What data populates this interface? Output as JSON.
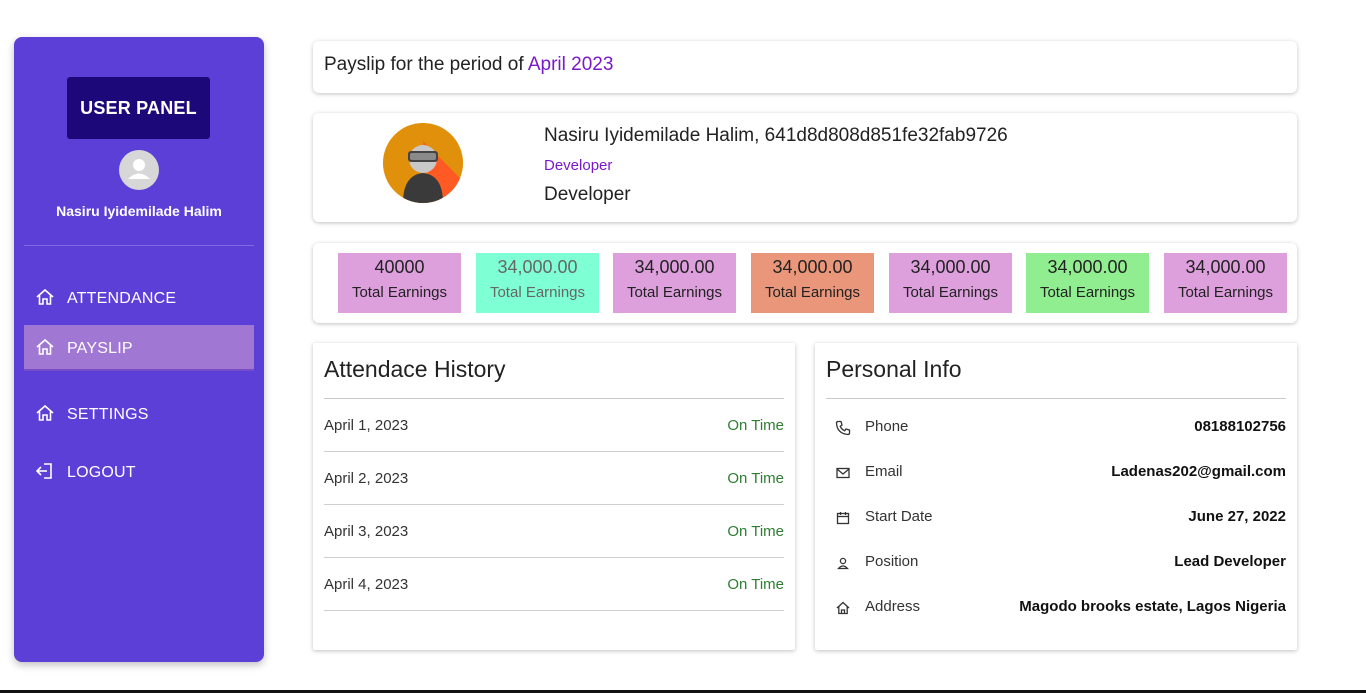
{
  "sidebar": {
    "panel_title": "USER PANEL",
    "user_name": "Nasiru Iyidemilade Halim",
    "items": [
      {
        "label": "ATTENDANCE",
        "icon": "home-icon",
        "active": false
      },
      {
        "label": "PAYSLIP",
        "icon": "home-icon",
        "active": true
      },
      {
        "label": "SETTINGS",
        "icon": "home-icon",
        "active": false
      },
      {
        "label": "LOGOUT",
        "icon": "logout-icon",
        "active": false
      }
    ]
  },
  "period": {
    "prefix": "Payslip for the period of ",
    "value": "April 2023"
  },
  "profile": {
    "name_line": "Nasiru Iyidemilade Halim, 641d8d808d851fe32fab9726",
    "role_small": "Developer",
    "role_large": "Developer"
  },
  "earnings": [
    {
      "amount": "40000",
      "label": "Total Earnings",
      "bg": "#dda0dd",
      "color": "#222222"
    },
    {
      "amount": "34,000.00",
      "label": "Total Earnings",
      "bg": "#7fffd4",
      "color": "#666666"
    },
    {
      "amount": "34,000.00",
      "label": "Total Earnings",
      "bg": "#dda0dd",
      "color": "#222222"
    },
    {
      "amount": "34,000.00",
      "label": "Total Earnings",
      "bg": "#e9967a",
      "color": "#222222"
    },
    {
      "amount": "34,000.00",
      "label": "Total Earnings",
      "bg": "#dda0dd",
      "color": "#222222"
    },
    {
      "amount": "34,000.00",
      "label": "Total Earnings",
      "bg": "#90ee90",
      "color": "#222222"
    },
    {
      "amount": "34,000.00",
      "label": "Total Earnings",
      "bg": "#dda0dd",
      "color": "#222222"
    }
  ],
  "attendance": {
    "title": "Attendace History",
    "rows": [
      {
        "date": "April 1, 2023",
        "status": "On Time"
      },
      {
        "date": "April 2, 2023",
        "status": "On Time"
      },
      {
        "date": "April 3, 2023",
        "status": "On Time"
      },
      {
        "date": "April 4, 2023",
        "status": "On Time"
      }
    ]
  },
  "personal": {
    "title": "Personal Info",
    "rows": [
      {
        "key": "Phone",
        "value": "08188102756",
        "icon": "phone-icon"
      },
      {
        "key": "Email",
        "value": "Ladenas202@gmail.com",
        "icon": "mail-icon"
      },
      {
        "key": "Start Date",
        "value": "June 27, 2022",
        "icon": "calendar-icon"
      },
      {
        "key": "Position",
        "value": "Lead Developer",
        "icon": "person-icon"
      },
      {
        "key": "Address",
        "value": "Magodo brooks estate, Lagos Nigeria",
        "icon": "house-icon"
      }
    ]
  },
  "colors": {
    "sidebar_bg": "#5b3fd6",
    "panel_badge_bg": "#1d0879",
    "active_item_bg": "#a177d4",
    "accent_purple": "#7b19c9",
    "status_green": "#2e7d32"
  }
}
